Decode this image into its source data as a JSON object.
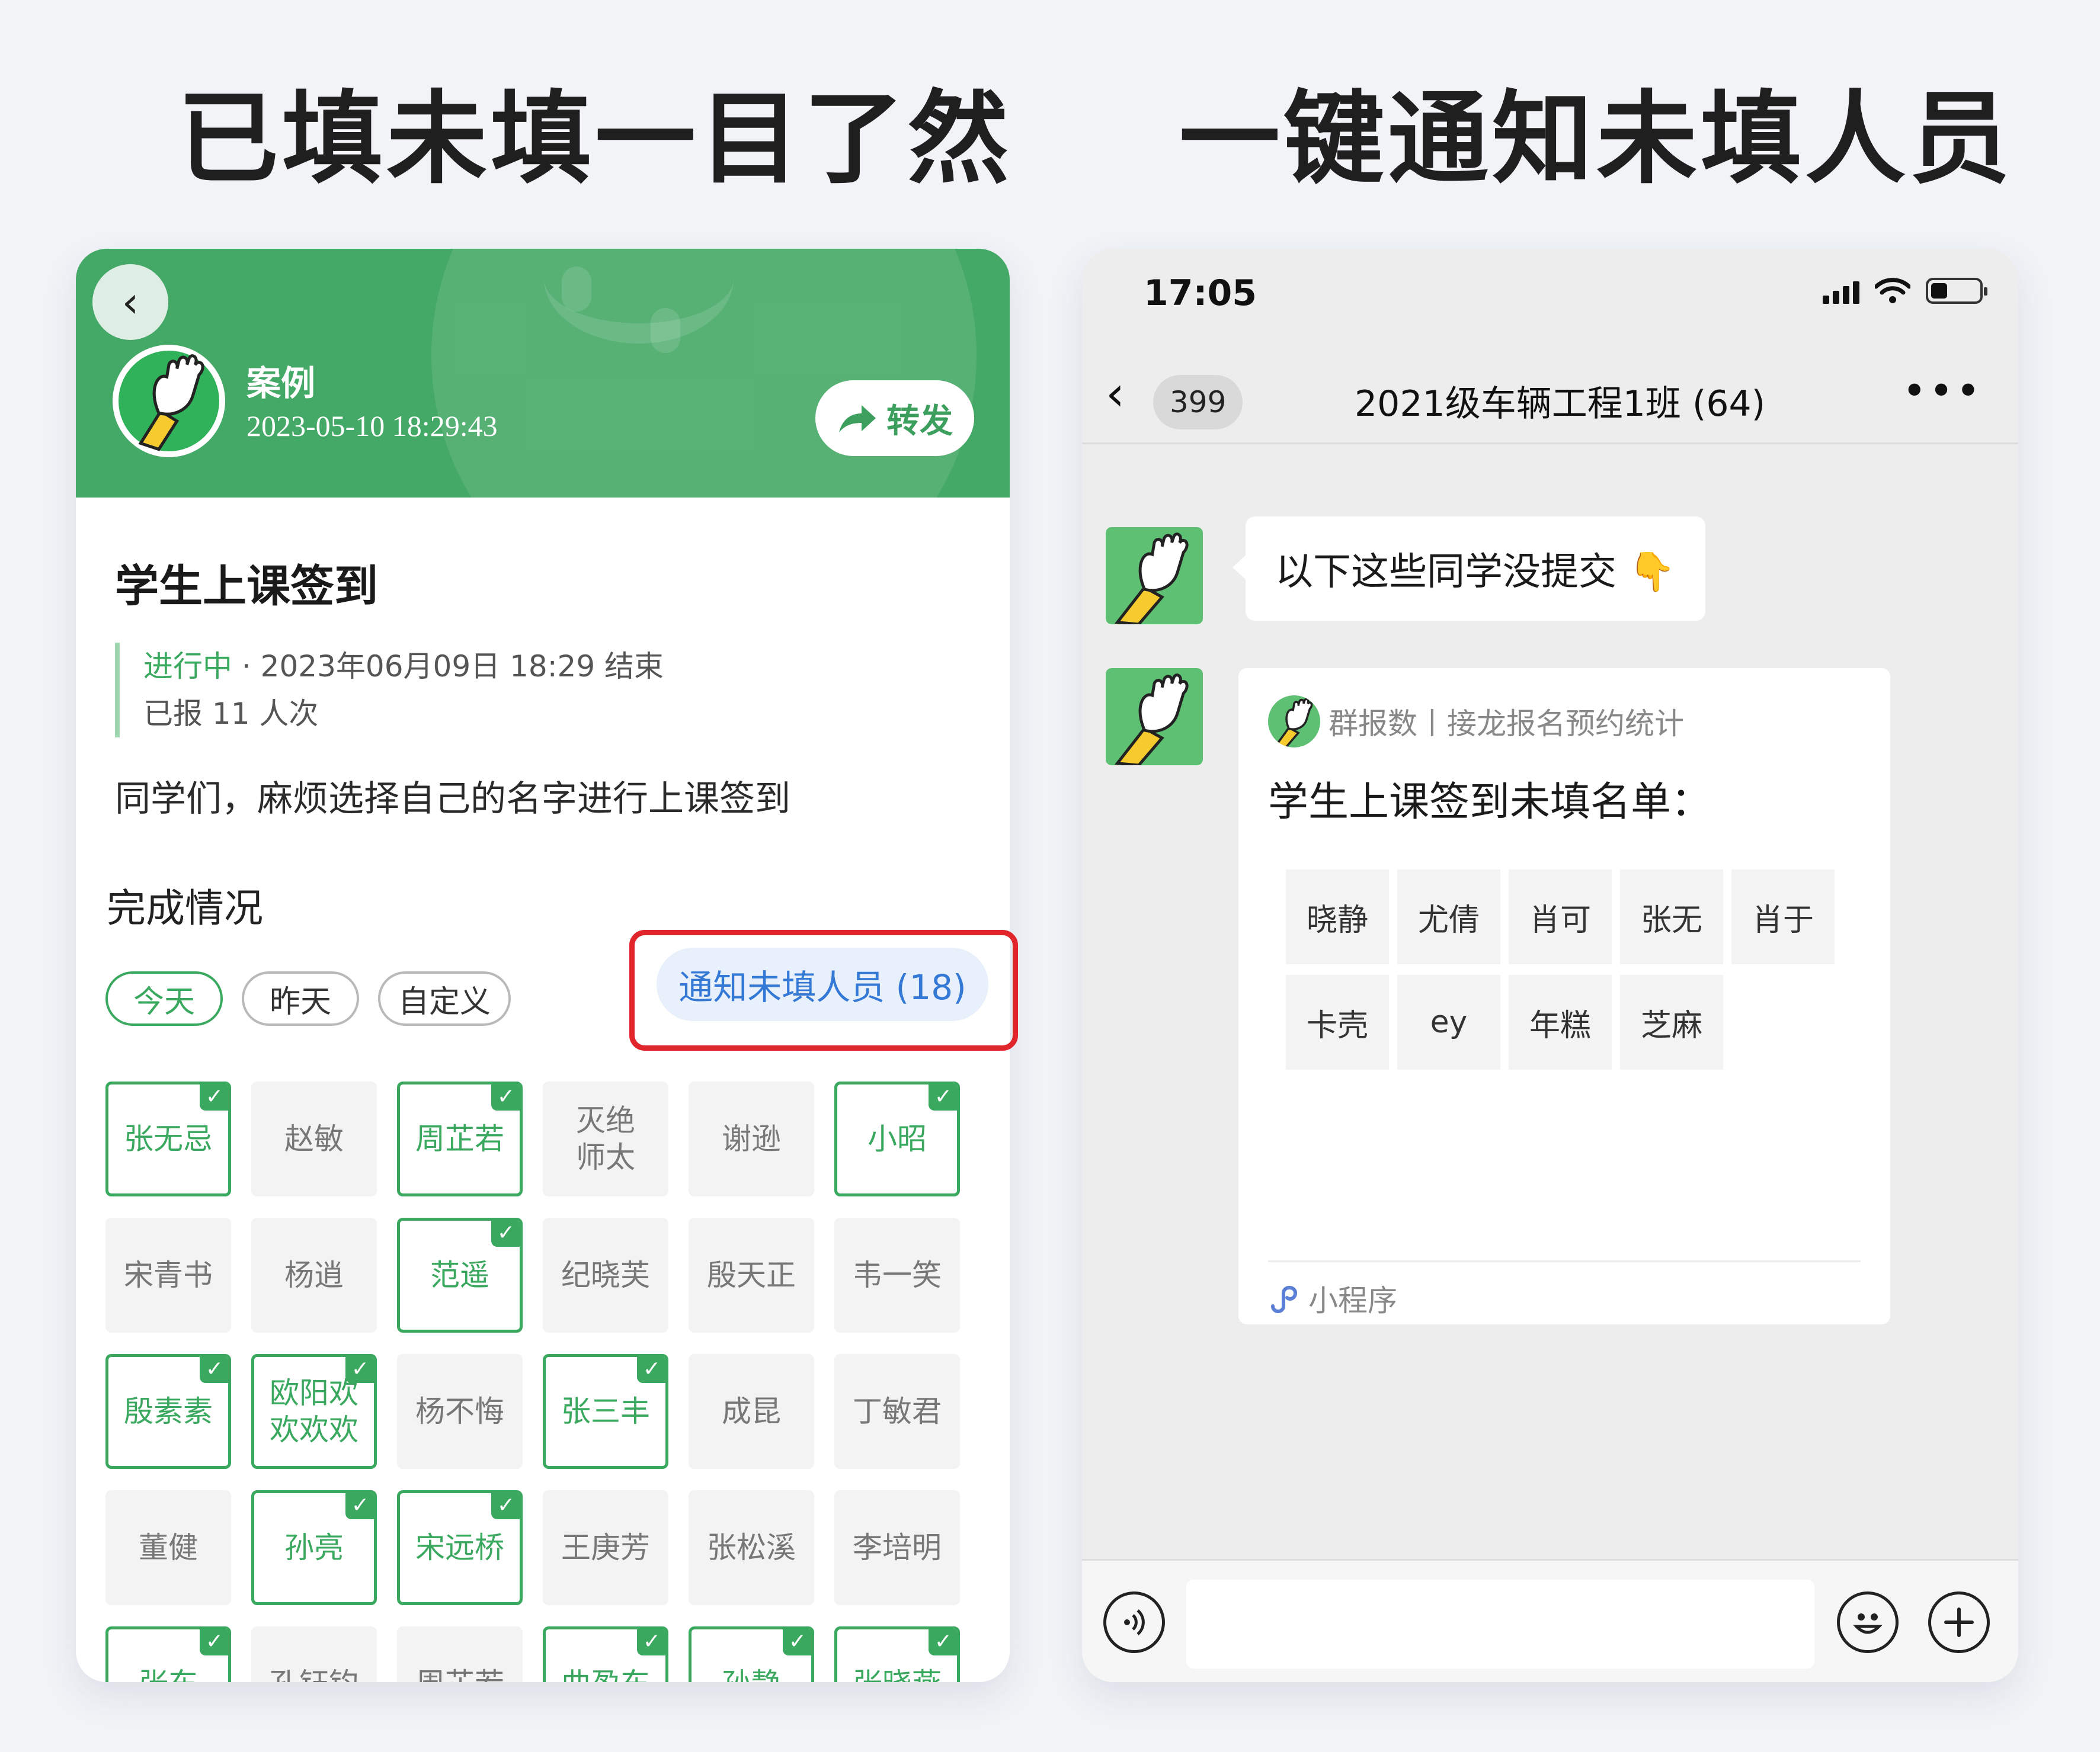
{
  "headlines": {
    "left": "已填未填一目了然",
    "right": "一键通知未填人员"
  },
  "left_screen": {
    "header": {
      "back_icon": "chevron-left-icon",
      "name": "案例",
      "datetime": "2023-05-10 18:29:43",
      "forward_label": "转发",
      "forward_icon": "share-arrow-icon"
    },
    "task_title": "学生上课签到",
    "status": {
      "state": "进行中",
      "end_text": " · 2023年06月09日 18:29 结束",
      "reported": "已报 11 人次"
    },
    "description": "同学们，麻烦选择自己的名字进行上课签到",
    "section_title": "完成情况",
    "filters": [
      {
        "label": "今天",
        "active": true
      },
      {
        "label": "昨天",
        "active": false
      },
      {
        "label": "自定义",
        "active": false
      }
    ],
    "notify_button": "通知未填人员 (18)",
    "names": [
      {
        "name": "张无忌",
        "done": true
      },
      {
        "name": "赵敏",
        "done": false
      },
      {
        "name": "周芷若",
        "done": true
      },
      {
        "name": "灭绝\n师太",
        "done": false
      },
      {
        "name": "谢逊",
        "done": false
      },
      {
        "name": "小昭",
        "done": true
      },
      {
        "name": "宋青书",
        "done": false
      },
      {
        "name": "杨逍",
        "done": false
      },
      {
        "name": "范遥",
        "done": true
      },
      {
        "name": "纪晓芙",
        "done": false
      },
      {
        "name": "殷天正",
        "done": false
      },
      {
        "name": "韦一笑",
        "done": false
      },
      {
        "name": "殷素素",
        "done": true
      },
      {
        "name": "欧阳欢\n欢欢欢",
        "done": true
      },
      {
        "name": "杨不悔",
        "done": false
      },
      {
        "name": "张三丰",
        "done": true
      },
      {
        "name": "成昆",
        "done": false
      },
      {
        "name": "丁敏君",
        "done": false
      },
      {
        "name": "董健",
        "done": false
      },
      {
        "name": "孙亮",
        "done": true
      },
      {
        "name": "宋远桥",
        "done": true
      },
      {
        "name": "王庚芳",
        "done": false
      },
      {
        "name": "张松溪",
        "done": false
      },
      {
        "name": "李培明",
        "done": false
      },
      {
        "name": "张东",
        "done": true
      },
      {
        "name": "孔钰钧",
        "done": false
      },
      {
        "name": "周芷若",
        "done": false
      },
      {
        "name": "曲盈东",
        "done": true
      },
      {
        "name": "孙静",
        "done": true
      },
      {
        "name": "张晓燕",
        "done": true
      }
    ]
  },
  "right_screen": {
    "status_bar": {
      "time": "17:05",
      "signal_icon": "signal-icon",
      "wifi_icon": "wifi-icon",
      "battery_icon": "battery-icon"
    },
    "nav": {
      "back_icon": "chevron-left-icon",
      "unread_count": "399",
      "title": "2021级车辆工程1班 (64)",
      "more_icon": "more-dots-icon"
    },
    "message1": "以下这些同学没提交 👇",
    "card": {
      "source": "群报数丨接龙报名预约统计",
      "title": "学生上课签到未填名单：",
      "names": [
        "晓静",
        "尤倩",
        "肖可",
        "张无",
        "肖于",
        "卡壳",
        "ey",
        "年糕",
        "芝麻"
      ],
      "footer": "小程序",
      "footer_icon": "mini-program-icon"
    },
    "input_bar": {
      "voice_icon": "voice-icon",
      "emoji_icon": "emoji-icon",
      "plus_icon": "plus-icon"
    }
  },
  "colors": {
    "brand_green": "#44a966",
    "done_green": "#3aa85f",
    "notify_blue": "#3579d6",
    "highlight_red": "#e0262b"
  }
}
